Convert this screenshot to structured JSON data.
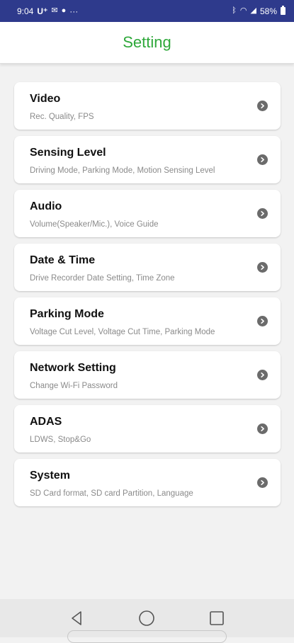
{
  "status_bar": {
    "time": "9:04",
    "carrier": "U⁺",
    "extra": "···",
    "battery": "58%"
  },
  "header": {
    "title": "Setting"
  },
  "settings": [
    {
      "title": "Video",
      "subtitle": "Rec. Quality, FPS"
    },
    {
      "title": "Sensing Level",
      "subtitle": "Driving Mode, Parking Mode, Motion Sensing Level"
    },
    {
      "title": "Audio",
      "subtitle": "Volume(Speaker/Mic.), Voice Guide"
    },
    {
      "title": "Date & Time",
      "subtitle": "Drive Recorder Date Setting, Time Zone"
    },
    {
      "title": "Parking Mode",
      "subtitle": "Voltage Cut Level, Voltage Cut Time, Parking Mode"
    },
    {
      "title": "Network Setting",
      "subtitle": "Change Wi-Fi Password"
    },
    {
      "title": "ADAS",
      "subtitle": "LDWS, Stop&Go"
    },
    {
      "title": "System",
      "subtitle": "SD Card format, SD card Partition, Language"
    }
  ],
  "colors": {
    "status_bar": "#2e3a8c",
    "accent": "#2ea83a",
    "background": "#f2f2f2"
  }
}
